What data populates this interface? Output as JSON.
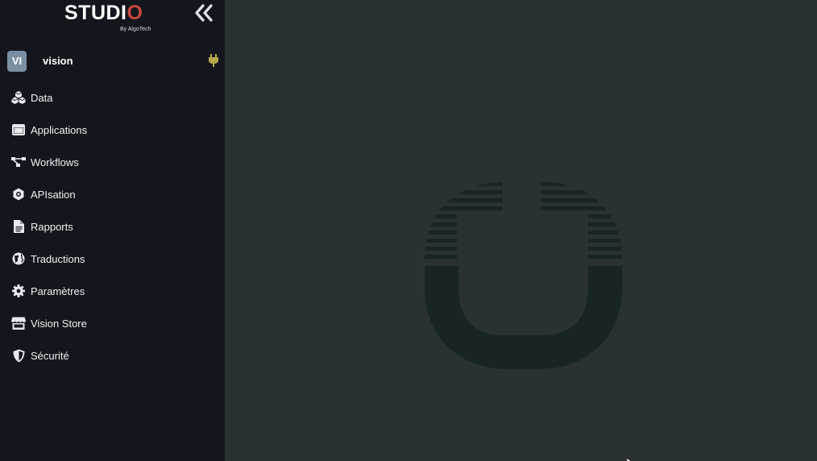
{
  "logo": {
    "text_main": "STUDI",
    "text_accent": "O",
    "subtitle": "By AlgoTech",
    "accent_color": "#c8473c"
  },
  "sidebar": {
    "collapse_icon": "double-chevron-left-icon",
    "project": {
      "avatar": "VI",
      "name": "vision",
      "status_icon": "plug-icon",
      "status_color": "#b6a94a"
    },
    "items": [
      {
        "label": "Data",
        "icon": "cubes-icon"
      },
      {
        "label": "Applications",
        "icon": "window-icon"
      },
      {
        "label": "Workflows",
        "icon": "workflow-icon"
      },
      {
        "label": "APIsation",
        "icon": "api-gear-icon"
      },
      {
        "label": "Rapports",
        "icon": "document-icon"
      },
      {
        "label": "Traductions",
        "icon": "globe-icon"
      },
      {
        "label": "Paramètres",
        "icon": "gear-icon"
      },
      {
        "label": "Vision Store",
        "icon": "store-icon"
      },
      {
        "label": "Sécurité",
        "icon": "shield-icon"
      }
    ]
  },
  "main": {
    "watermark_icon": "studio-logo-watermark-icon"
  },
  "colors": {
    "sidebar_bg": "#14161e",
    "main_bg": "#2a3133",
    "watermark": "#172524"
  }
}
